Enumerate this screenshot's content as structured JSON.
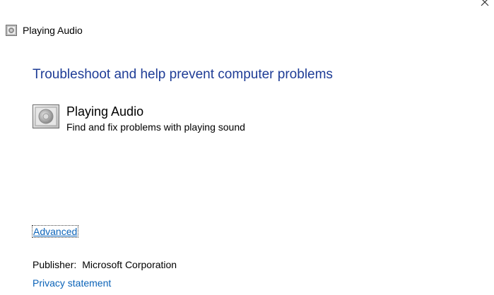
{
  "window": {
    "title": "Playing Audio",
    "close_icon": "close-icon"
  },
  "main": {
    "heading": "Troubleshoot and help prevent computer problems",
    "troubleshooter": {
      "icon": "speaker-icon",
      "title": "Playing Audio",
      "description": "Find and fix problems with playing sound"
    },
    "advanced_label": "Advanced",
    "publisher_label": "Publisher:",
    "publisher_value": "Microsoft Corporation",
    "privacy_label": "Privacy statement"
  },
  "colors": {
    "heading": "#1e3c96",
    "link": "#0b63b8",
    "background": "#ffffff"
  }
}
